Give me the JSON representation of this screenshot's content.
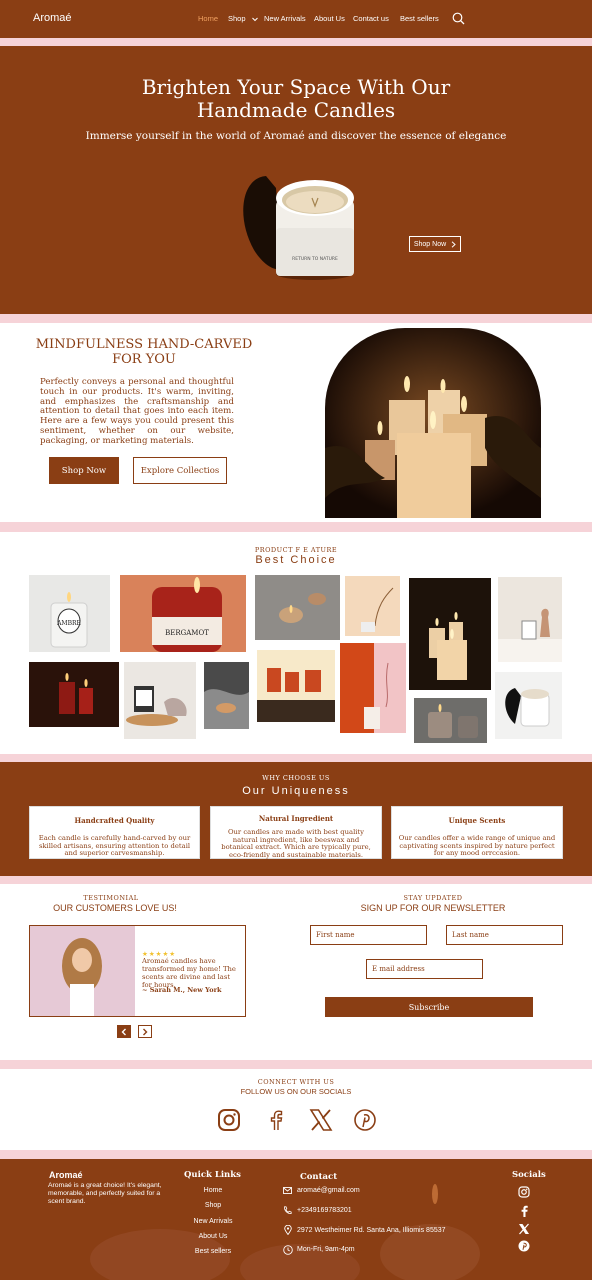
{
  "header": {
    "logo": "Aromaé",
    "nav": [
      "Home",
      "Shop",
      "New Arrivals",
      "About Us",
      "Contact us",
      "Best sellers"
    ]
  },
  "hero": {
    "title_line1": "Brighten Your Space With Our",
    "title_line2": "Handmade Candles",
    "subtitle": "Immerse yourself in the world of Aromaé and discover the essence of elegance",
    "shop_button": "Shop Now",
    "candle_label": "RETURN TO NATURE"
  },
  "mindfulness": {
    "title": "MINDFULNESS HAND-CARVED FOR YOU",
    "text": "Perfectly conveys a personal and thoughtful touch in our products. It's warm, inviting, and emphasizes the craftsmanship and attention to detail that goes into each item. Here are a few ways you could present this sentiment, whether on our website, packaging, or marketing materials.",
    "shop_button": "Shop Now",
    "explore_button": "Explore Collectios"
  },
  "best_choice": {
    "eyebrow": "PRODUCT  F E ATURE",
    "title": "Best Choice",
    "label_ambre": "AMBRE",
    "label_bergamot": "BERGAMOT"
  },
  "uniqueness": {
    "eyebrow": "WHY  CHOOSE US",
    "title": "Our Uniqueness",
    "cards": [
      {
        "title": "Handcrafted Quality",
        "text": "Each candle is carefully hand-carved by our skilled artisans, ensuring attention to detail and superior carvesmanship."
      },
      {
        "title": "Natural Ingredient",
        "text": "Our candles are made with best quality natural ingredient, like beeswax and botanical extract. Which are typically pure, eco-friendly and sustainable materials."
      },
      {
        "title": "Unique Scents",
        "text": "Our candles offer a wide range of unique and captivating scents inspired by nature perfect for any mood orrccasion."
      }
    ]
  },
  "testimonial": {
    "eyebrow": "TESTIMONIAL",
    "title": "OUR CUSTOMERS LOVE US!",
    "stars": "★★★★★",
    "quote": "Aromaé candles have transformed my home! The scents are divine and last for hours.",
    "author": "~ Sarah M., New York"
  },
  "newsletter": {
    "eyebrow": "STAY UPDATED",
    "title": "SIGN UP FOR OUR NEWSLETTER",
    "first_name": "First name",
    "last_name": "Last name",
    "email": "E mail address",
    "subscribe": "Subscribe"
  },
  "socials": {
    "eyebrow": "CONNECT WITH US",
    "title": "FOLLOW US ON OUR SOCIALS",
    "icons": [
      "instagram-icon",
      "facebook-icon",
      "x-icon",
      "pinterest-icon"
    ]
  },
  "footer": {
    "brand": "Aromaé",
    "brand_text": "Aromaé is a great choice! It's elegant, memorable, and perfectly suited for a scent brand.",
    "quick_links_title": "Quick Links",
    "quick_links": [
      "Home",
      "Shop",
      "New Arrivals",
      "About Us",
      "Best sellers"
    ],
    "contact_title": "Contact",
    "email": "aromaé@gmail.com",
    "phone": "+2349169783201",
    "address": "2972 Westheimer Rd. Santa Ana, Illiomis 85537",
    "hours": "Mon-Fri, 9am-4pm",
    "socials_title": "Socials"
  },
  "colors": {
    "brand_brown": "#8a3e14",
    "pink_divider": "#f6d3d8",
    "active_nav": "#f0a060"
  }
}
